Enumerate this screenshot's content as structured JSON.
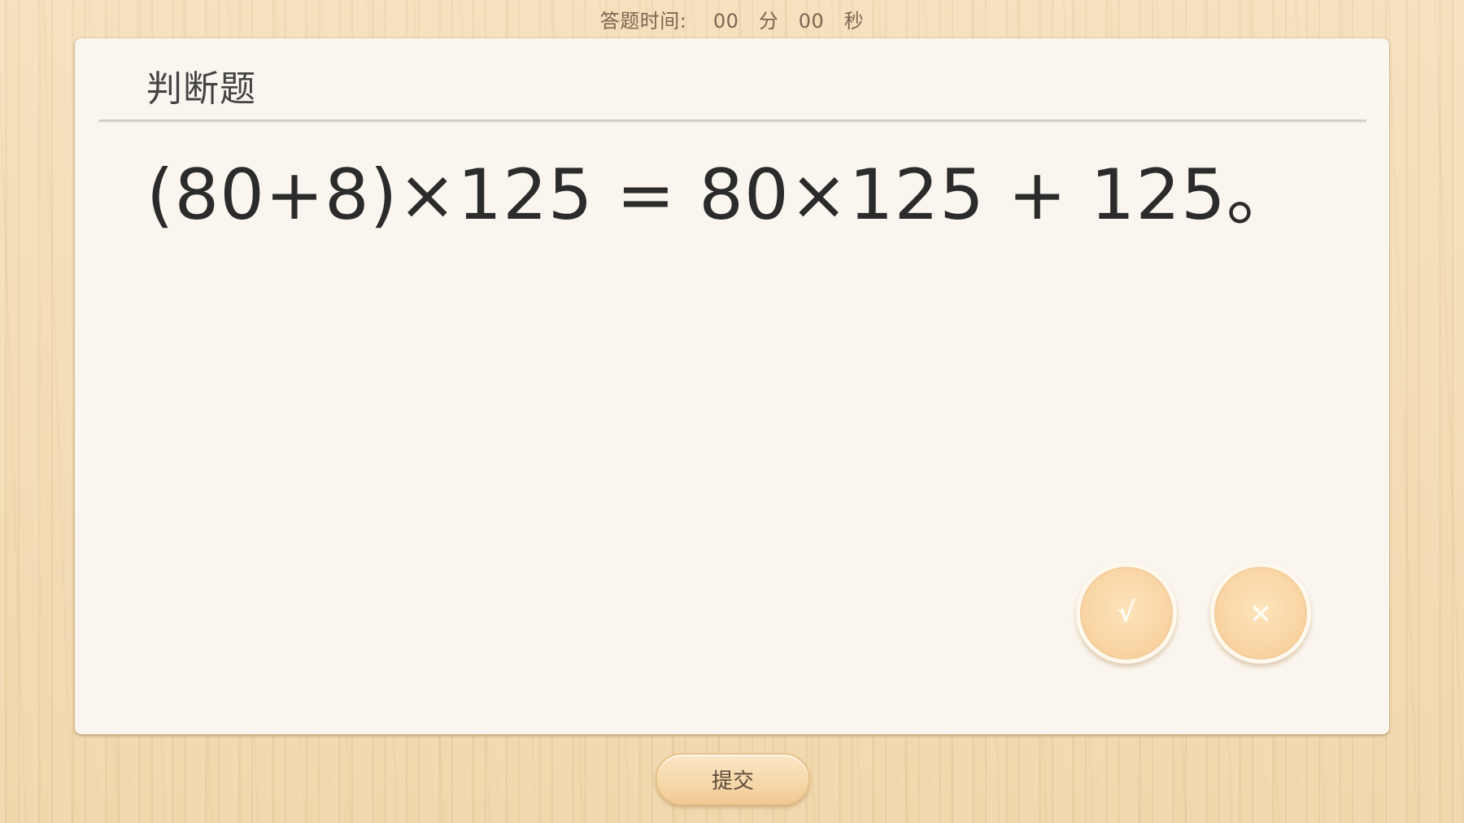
{
  "timer": {
    "label": "答题时间:",
    "minutes": "00",
    "minutes_unit": "分",
    "seconds": "00",
    "seconds_unit": "秒"
  },
  "card": {
    "title": "判断题",
    "question": "(80+8)×125 = 80×125 + 125。"
  },
  "answers": {
    "true_label": "√",
    "false_label": "×"
  },
  "submit": {
    "label": "提交"
  },
  "colors": {
    "background": "#f2d9b0",
    "card": "#faf6ef",
    "button": "#f9d5a4"
  },
  "icons": {
    "true": "check-icon",
    "false": "cross-icon"
  }
}
